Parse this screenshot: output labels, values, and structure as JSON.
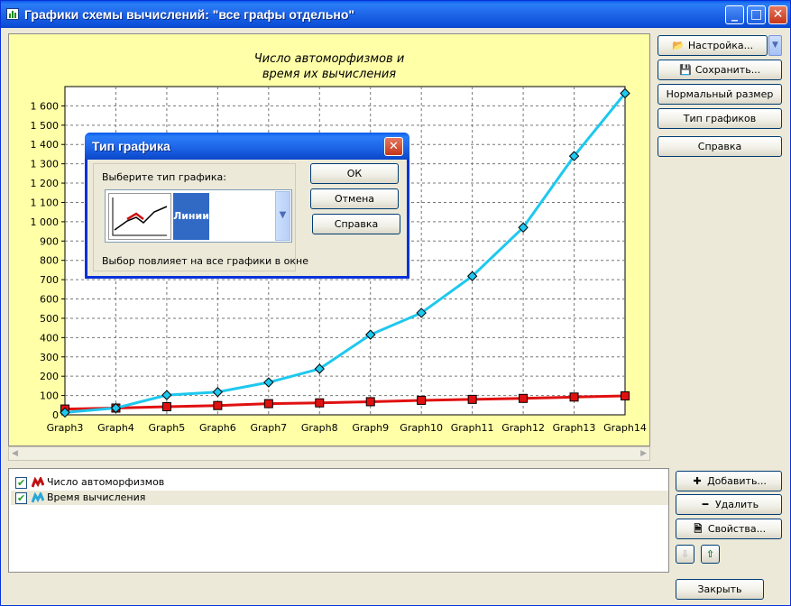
{
  "window": {
    "title": "Графики схемы вычислений: \"все графы отдельно\"",
    "minimize_glyph": "_",
    "maximize_glyph": "□",
    "close_glyph": "✕"
  },
  "chart": {
    "title_line1": "Число автоморфизмов и",
    "title_line2": "время их вычисления"
  },
  "chart_data": {
    "type": "line",
    "title": "Число автоморфизмов и время их вычисления",
    "categories": [
      "Graph3",
      "Graph4",
      "Graph5",
      "Graph6",
      "Graph7",
      "Graph8",
      "Graph9",
      "Graph10",
      "Graph11",
      "Graph12",
      "Graph13",
      "Graph14"
    ],
    "ylim": [
      0,
      1700
    ],
    "yticks": [
      0,
      100,
      200,
      300,
      400,
      500,
      600,
      700,
      800,
      900,
      1000,
      1100,
      1200,
      1300,
      1400,
      1500,
      1600
    ],
    "ytick_labels": [
      "0",
      "100",
      "200",
      "300",
      "400",
      "500",
      "600",
      "700",
      "800",
      "900",
      "1 000",
      "1 100",
      "1 200",
      "1 300",
      "1 400",
      "1 500",
      "1 600"
    ],
    "grid": true,
    "series": [
      {
        "name": "Число автоморфизмов",
        "color": "#e01010",
        "marker": "square",
        "values": [
          30,
          35,
          42,
          48,
          58,
          62,
          68,
          75,
          80,
          85,
          92,
          98
        ]
      },
      {
        "name": "Время вычисления",
        "color": "#1ec8ee",
        "marker": "diamond",
        "values": [
          12,
          35,
          102,
          118,
          168,
          238,
          415,
          528,
          718,
          970,
          1340,
          1665
        ]
      }
    ]
  },
  "side_buttons": {
    "settings": "Настройка...",
    "save": "Сохранить...",
    "normal_size": "Нормальный размер",
    "chart_type": "Тип графиков",
    "help": "Справка"
  },
  "list": {
    "items": [
      {
        "label": "Число автоморфизмов",
        "checked": "✔"
      },
      {
        "label": "Время вычисления",
        "checked": "✔"
      }
    ]
  },
  "list_buttons": {
    "add": "Добавить...",
    "remove": "Удалить",
    "properties": "Свойства...",
    "down_glyph": "⇩",
    "up_glyph": "⇧"
  },
  "close_button": "Закрыть",
  "dialog": {
    "title": "Тип графика",
    "choose_label": "Выберите тип графика:",
    "selected_type": "Линии",
    "note": "Выбор повлияет на все графики в окне",
    "ok": "ОК",
    "cancel": "Отмена",
    "help": "Справка",
    "close_glyph": "✕"
  }
}
